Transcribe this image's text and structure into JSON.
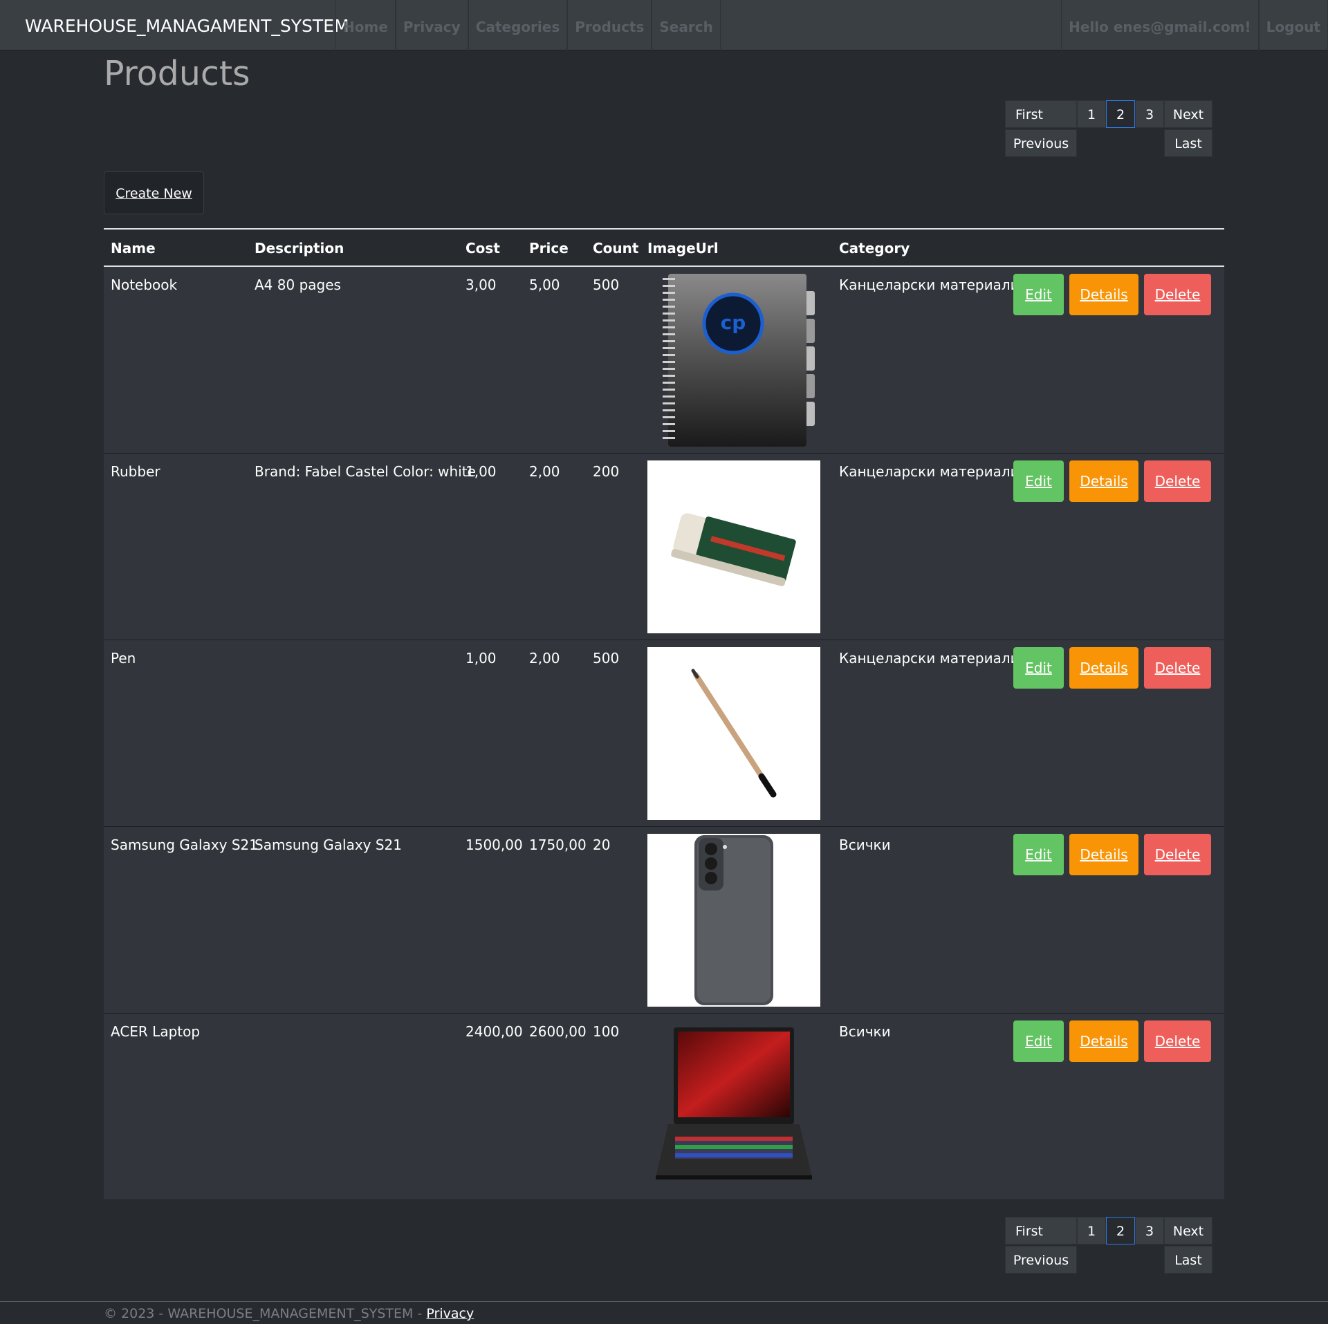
{
  "navbar": {
    "brand": "WAREHOUSE_MANAGAMENT_SYSTEM",
    "links": [
      "Home",
      "Privacy",
      "Categories",
      "Products",
      "Search"
    ],
    "greeting": "Hello enes@gmail.com!",
    "logout": "Logout"
  },
  "page": {
    "title": "Products",
    "create_new": "Create New"
  },
  "pager": {
    "first": "First",
    "pages": [
      "1",
      "2",
      "3"
    ],
    "current_page": "2",
    "next": "Next",
    "previous": "Previous",
    "last": "Last"
  },
  "table": {
    "headers": {
      "name": "Name",
      "description": "Description",
      "cost": "Cost",
      "price": "Price",
      "count": "Count",
      "image_url": "ImageUrl",
      "category": "Category"
    },
    "rows": [
      {
        "name": "Notebook",
        "description": "A4 80 pages",
        "cost": "3,00",
        "price": "5,00",
        "count": "500",
        "image": "notebook-image",
        "category": "Канцеларски материали"
      },
      {
        "name": "Rubber",
        "description": "Brand: Fabel Castel Color: white",
        "cost": "1,00",
        "price": "2,00",
        "count": "200",
        "image": "eraser-image",
        "category": "Канцеларски материали"
      },
      {
        "name": "Pen",
        "description": "",
        "cost": "1,00",
        "price": "2,00",
        "count": "500",
        "image": "pencil-image",
        "category": "Канцеларски материали"
      },
      {
        "name": "Samsung Galaxy S21",
        "description": "Samsung Galaxy S21",
        "cost": "1500,00",
        "price": "1750,00",
        "count": "20",
        "image": "phone-image",
        "category": "Всички"
      },
      {
        "name": "ACER Laptop",
        "description": "",
        "cost": "2400,00",
        "price": "2600,00",
        "count": "100",
        "image": "laptop-image",
        "category": "Всички"
      }
    ],
    "actions": {
      "edit": "Edit",
      "details": "Details",
      "delete": "Delete"
    }
  },
  "footer": {
    "text": "© 2023 - WAREHOUSE_MANAGEMENT_SYSTEM -",
    "privacy": "Privacy"
  },
  "colors": {
    "background": "#272b30",
    "navbar": "#3a3f44",
    "row": "#32363c",
    "edit": "#62c462",
    "details": "#f89406",
    "delete": "#ee5f5b",
    "active_page_border": "#2b7be5"
  }
}
